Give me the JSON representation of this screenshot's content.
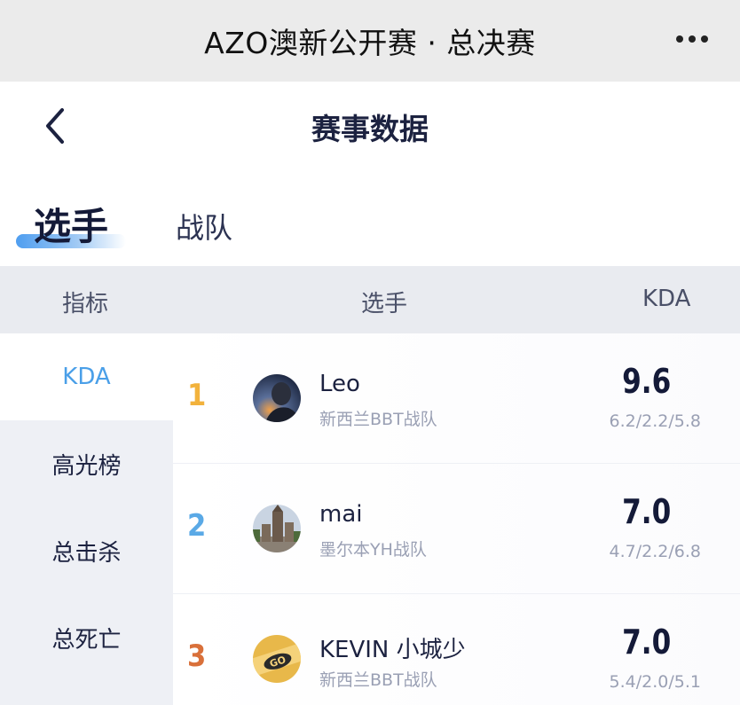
{
  "appbar": {
    "title": "AZO澳新公开赛 · 总决赛",
    "more_icon": "more-dots-icon"
  },
  "page": {
    "title": "赛事数据",
    "back_icon": "chevron-left-icon"
  },
  "tabs": [
    {
      "label": "选手",
      "active": true
    },
    {
      "label": "战队",
      "active": false
    }
  ],
  "table_header": {
    "metric": "指标",
    "player": "选手",
    "kda": "KDA"
  },
  "sidebar": {
    "items": [
      {
        "label": "KDA",
        "active": true
      },
      {
        "label": "高光榜",
        "active": false
      },
      {
        "label": "总击杀",
        "active": false
      },
      {
        "label": "总死亡",
        "active": false
      }
    ]
  },
  "colors": {
    "accent": "#4a9fe8",
    "rank_1": "#f2b23c",
    "rank_2": "#5aa9e6",
    "rank_3": "#d9703a"
  },
  "rows": [
    {
      "rank": "1",
      "name": "Leo",
      "team": "新西兰BBT战队",
      "kda": "9.6",
      "detail": "6.2/2.2/5.8",
      "avatar_icon": "player-avatar-leo"
    },
    {
      "rank": "2",
      "name": "mai",
      "team": "墨尔本YH战队",
      "kda": "7.0",
      "detail": "4.7/2.2/6.8",
      "avatar_icon": "player-avatar-mai"
    },
    {
      "rank": "3",
      "name": "KEVIN 小城少",
      "team": "新西兰BBT战队",
      "kda": "7.0",
      "detail": "5.4/2.0/5.1",
      "avatar_icon": "player-avatar-kevin"
    }
  ]
}
